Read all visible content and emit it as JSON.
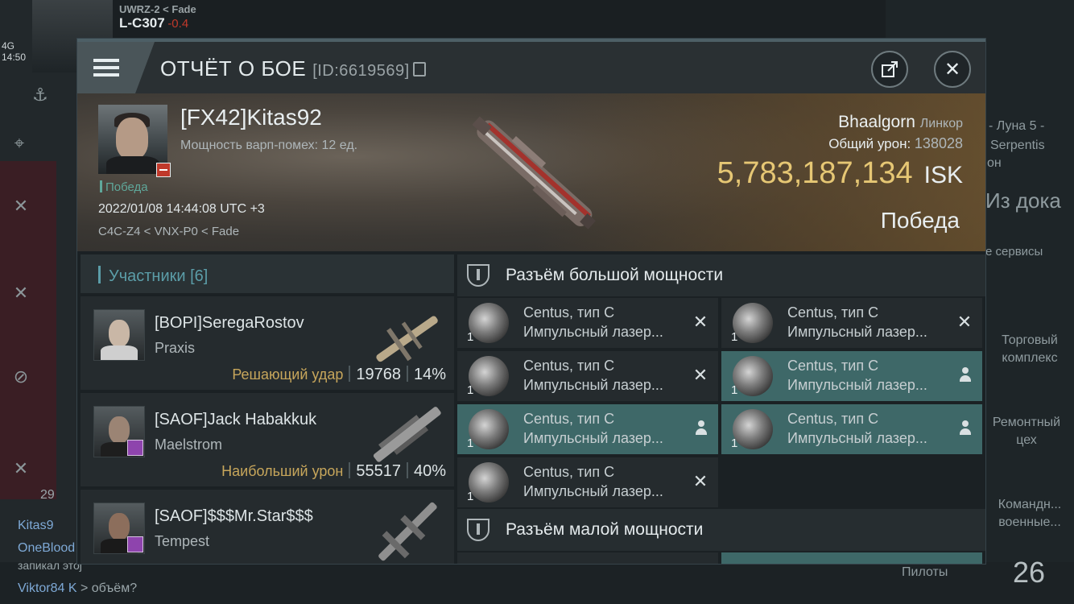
{
  "hud": {
    "system_region": "UWRZ-2",
    "system_constellation": "< Fade",
    "system_name": "L-C307",
    "system_security": "-0.4",
    "network": "4G",
    "clock": "14:50",
    "right_labels": [
      "- Луна 5 -",
      "Serpentis",
      "он",
      "Из дока",
      "е сервисы",
      "Торговый",
      "комплекс",
      "Ремонтный",
      "цех",
      "Командн...",
      "военные..."
    ],
    "chat": {
      "count": "29",
      "user1": "Kitas9",
      "user2": "OneBlood",
      "line3": "запикал этоj",
      "user4": "Viktor84 K",
      "msg4": "> объём?"
    },
    "pilots_label": "Пилоты",
    "pilots_count": "26"
  },
  "report": {
    "title": "ОТЧЁТ О БОЕ",
    "report_id": "[ID:6619569]",
    "victim": {
      "name": "[FX42]Kitas92",
      "warp_scramble": "Мощность варп-помех: 12 ед.",
      "result_small": "Победа",
      "datetime": "2022/01/08 14:44:08 UTC +3",
      "route": "C4C-Z4 < VNX-P0 < Fade",
      "ship_name": "Bhaalgorn",
      "ship_class": "Линкор",
      "total_damage_label": "Общий урон:",
      "total_damage": "138028",
      "isk_value": "5,783,187,134",
      "isk_unit": "ISK",
      "result_big": "Победа"
    },
    "participants": {
      "title": "Участники [6]",
      "items": [
        {
          "name": "[BOPI]SeregaRostov",
          "ship": "Praxis",
          "tag": "Решающий удар",
          "damage": "19768",
          "percent": "14%"
        },
        {
          "name": "[SAOF]Jack Habakkuk",
          "ship": "Maelstrom",
          "tag": "Наибольший урон",
          "damage": "55517",
          "percent": "40%"
        },
        {
          "name": "[SAOF]$$$Mr.Star$$$",
          "ship": "Tempest",
          "tag": "",
          "damage": "",
          "percent": ""
        }
      ]
    },
    "fittings": {
      "high_title": "Разъём большой мощности",
      "low_title": "Разъём малой мощности",
      "modules": [
        {
          "line1": "Centus, тип C",
          "line2": "Импульсный лазер...",
          "qty": "1",
          "state": "destroyed"
        },
        {
          "line1": "Centus, тип C",
          "line2": "Импульсный лазер...",
          "qty": "1",
          "state": "destroyed"
        },
        {
          "line1": "Centus, тип C",
          "line2": "Импульсный лазер...",
          "qty": "1",
          "state": "destroyed"
        },
        {
          "line1": "Centus, тип C",
          "line2": "Импульсный лазер...",
          "qty": "1",
          "state": "dropped"
        },
        {
          "line1": "Centus, тип C",
          "line2": "Импульсный лазер...",
          "qty": "1",
          "state": "dropped"
        },
        {
          "line1": "Centus, тип C",
          "line2": "Импульсный лазер...",
          "qty": "1",
          "state": "dropped"
        },
        {
          "line1": "Centus, тип C",
          "line2": "Импульсный лазер...",
          "qty": "1",
          "state": "destroyed"
        }
      ]
    },
    "icons": {
      "menu": "menu-icon",
      "share": "share-icon",
      "close": "close-icon",
      "copy": "copy-icon",
      "destroyed": "cross-icon",
      "dropped": "person-icon"
    }
  }
}
